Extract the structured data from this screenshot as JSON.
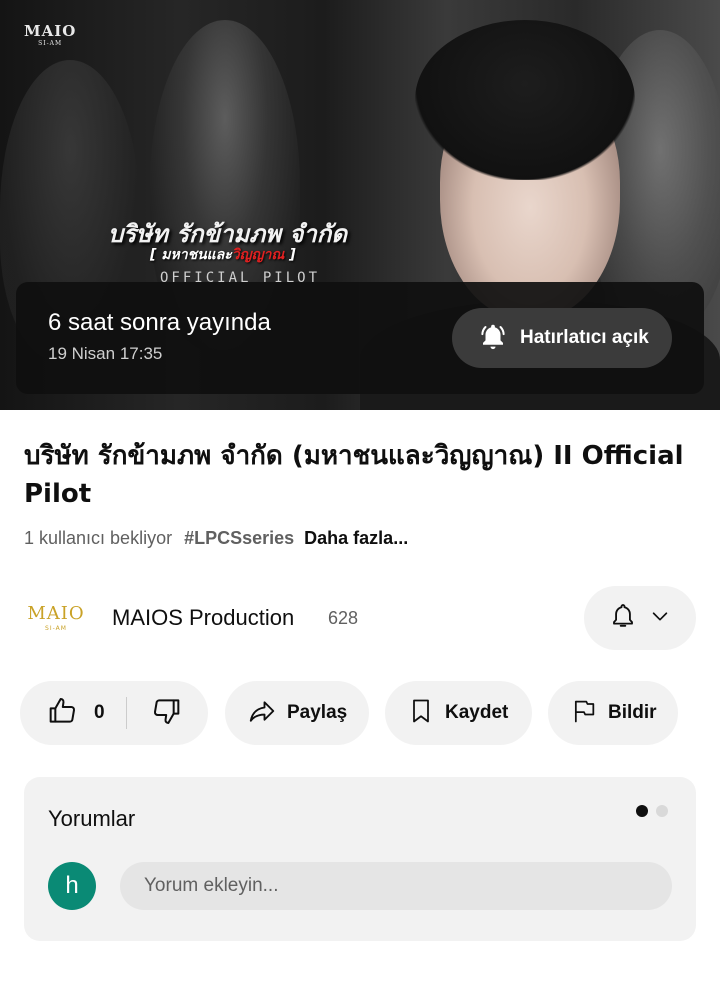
{
  "thumbnail": {
    "brand_logo": "MAIO",
    "brand_logo_sub": "SI-AM",
    "title_art": "บริษัท รักข้ามภพ จำกัด",
    "subtitle_art_prefix": "[ มหาชนและ",
    "subtitle_art_red": "วิญญาณ",
    "subtitle_art_suffix": " ]",
    "pilot_tag": "OFFICIAL PILOT"
  },
  "premiere": {
    "when": "6 saat sonra yayında",
    "date": "19 Nisan 17:35",
    "reminder_label": "Hatırlatıcı açık"
  },
  "video": {
    "title": "บริษัท รักข้ามภพ จำกัด (มหาชนและวิญญาณ) II Official Pilot",
    "waiting": "1 kullanıcı bekliyor",
    "hashtag": "#LPCSseries",
    "more": "Daha fazla..."
  },
  "channel": {
    "avatar_text": "MAIO",
    "avatar_sub": "SI-AM",
    "name": "MAIOS Production",
    "subscribers": "628"
  },
  "actions": {
    "likes": "0",
    "share": "Paylaş",
    "save": "Kaydet",
    "report": "Bildir"
  },
  "comments": {
    "title": "Yorumlar",
    "user_initial": "h",
    "placeholder": "Yorum ekleyin..."
  },
  "colors": {
    "user_avatar": "#0a8a75",
    "pill_bg": "#f2f2f2",
    "channel_logo": "#c9a227"
  }
}
